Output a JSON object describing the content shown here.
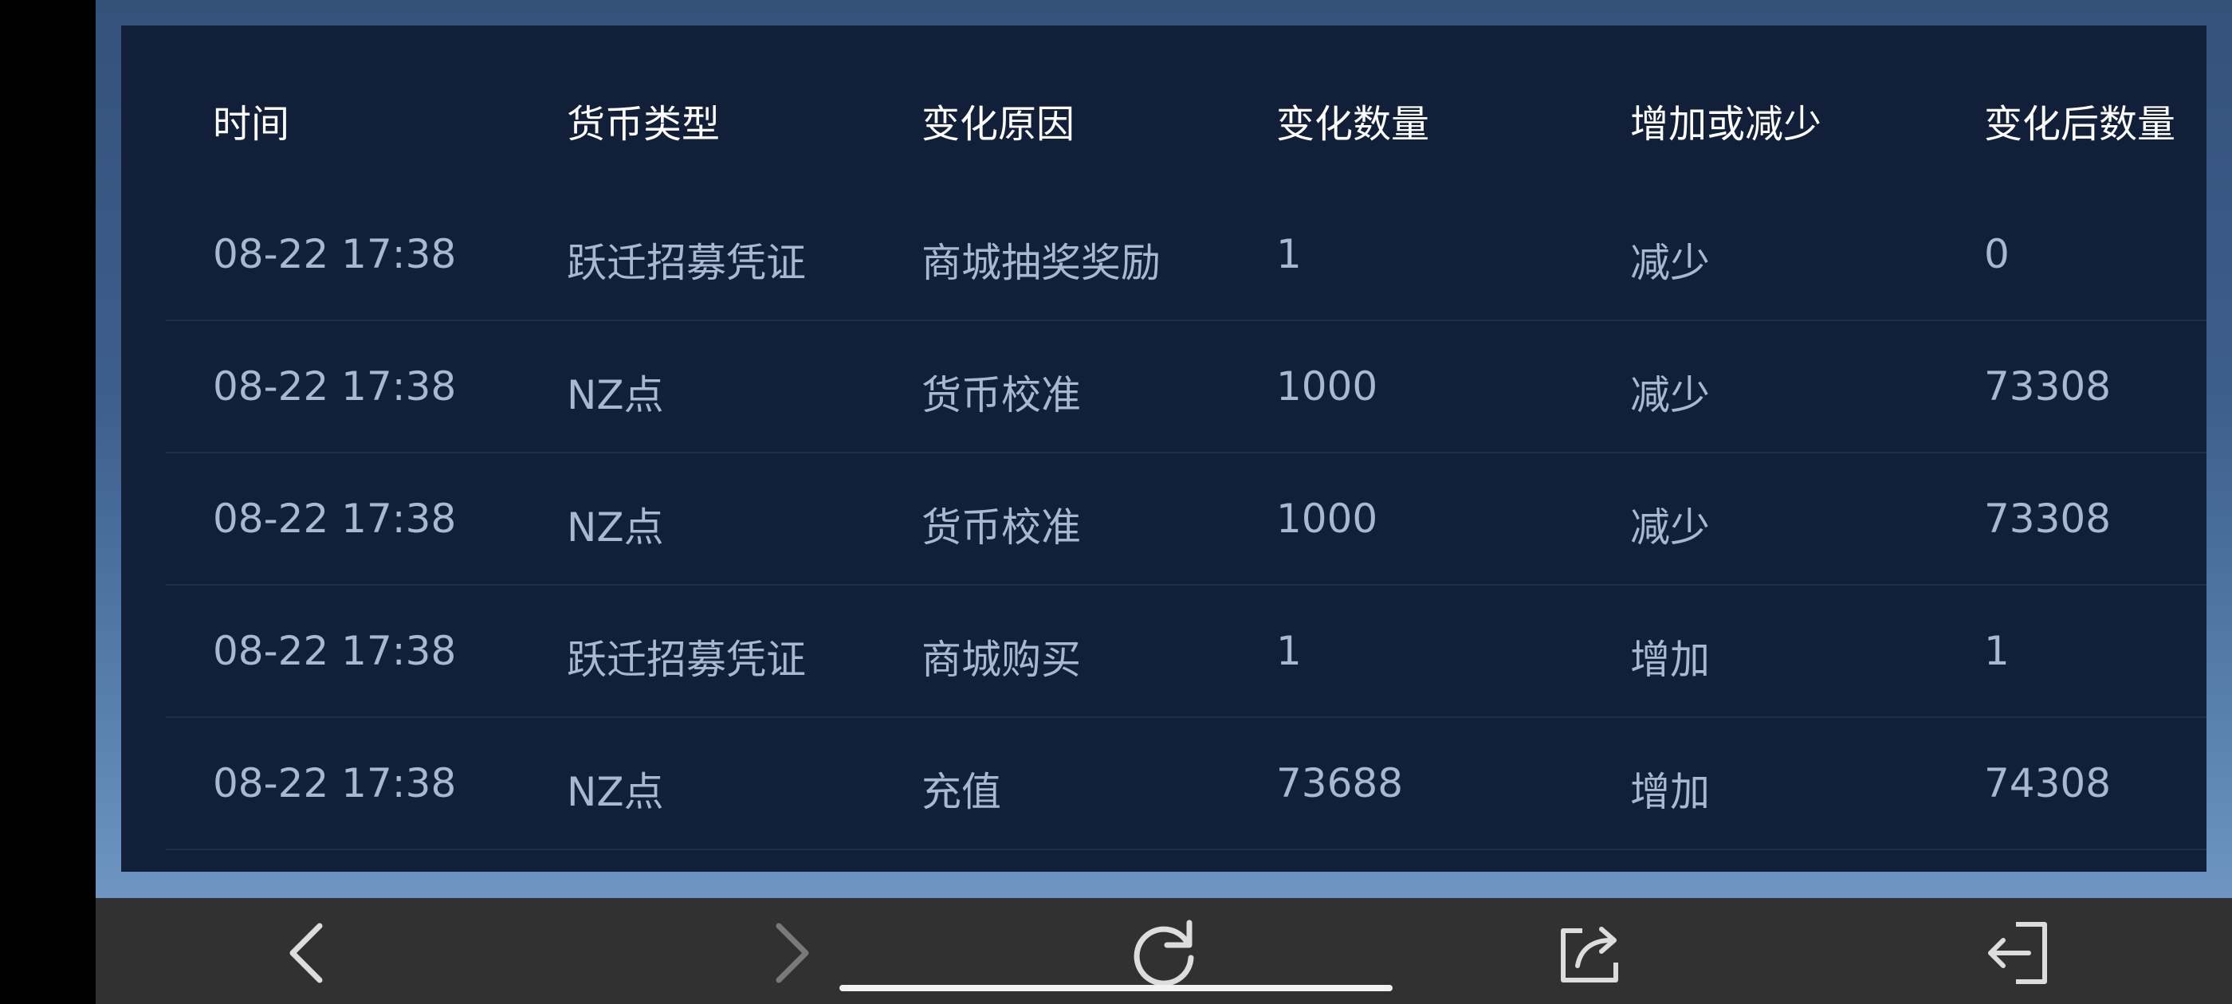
{
  "table": {
    "headers": [
      "时间",
      "货币类型",
      "变化原因",
      "变化数量",
      "增加或减少",
      "变化后数量"
    ],
    "rows": [
      [
        "08-22 17:38",
        "跃迁招募凭证",
        "商城抽奖奖励",
        "1",
        "减少",
        "0"
      ],
      [
        "08-22 17:38",
        "NZ点",
        "货币校准",
        "1000",
        "减少",
        "73308"
      ],
      [
        "08-22 17:38",
        "NZ点",
        "货币校准",
        "1000",
        "减少",
        "73308"
      ],
      [
        "08-22 17:38",
        "跃迁招募凭证",
        "商城购买",
        "1",
        "增加",
        "1"
      ],
      [
        "08-22 17:38",
        "NZ点",
        "充值",
        "73688",
        "增加",
        "74308"
      ]
    ]
  },
  "navbar": {
    "buttons": [
      {
        "name": "back",
        "icon": "chevron-left-icon",
        "enabled": true
      },
      {
        "name": "forward",
        "icon": "chevron-right-icon",
        "enabled": false
      },
      {
        "name": "refresh",
        "icon": "refresh-icon",
        "enabled": true
      },
      {
        "name": "share",
        "icon": "share-icon",
        "enabled": true
      },
      {
        "name": "exit",
        "icon": "exit-icon",
        "enabled": true
      }
    ]
  },
  "colors": {
    "panel_bg": "#112038",
    "header_text": "#ffffff",
    "cell_text": "#a9b8cc",
    "navbar_bg": "#313131",
    "icon_enabled": "#dddddd",
    "icon_disabled": "#7a7a7a"
  }
}
